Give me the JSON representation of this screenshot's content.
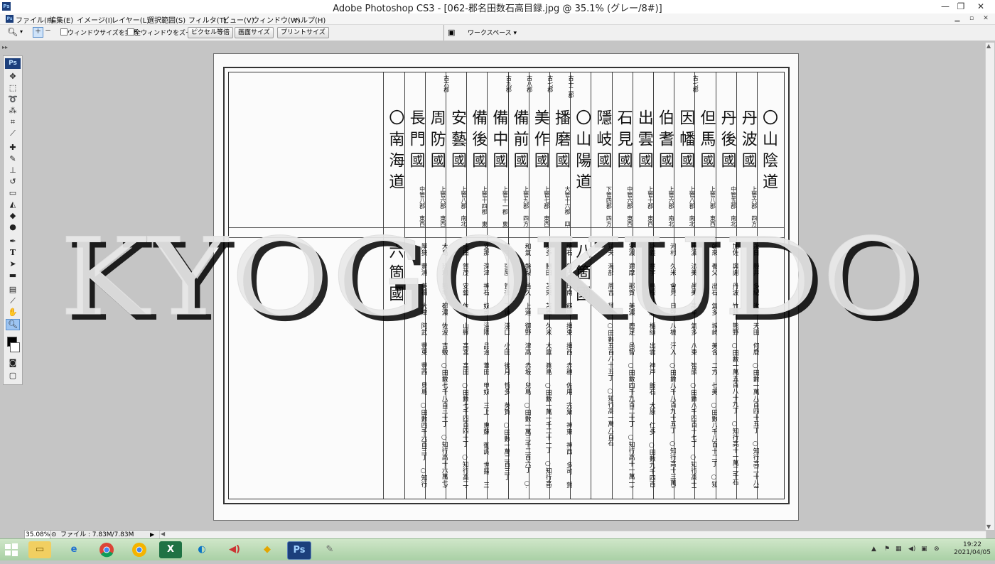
{
  "window": {
    "title": "Adobe Photoshop CS3 - [062-郡名田数石高目録.jpg @ 35.1% (グレー/8#)]",
    "app_icon": "Ps"
  },
  "menu": {
    "items": [
      "ファイル(F)",
      "編集(E)",
      "イメージ(I)",
      "レイヤー(L)",
      "選択範囲(S)",
      "フィルタ(T)",
      "ビュー(V)",
      "ウィンドウ(W)",
      "ヘルプ(H)"
    ]
  },
  "options": {
    "resize_windows_label": "ウィンドウサイズを変更",
    "zoom_all_label": "全ウィンドウをズーム",
    "actual_pixels_label": "ピクセル等倍",
    "fit_screen_label": "画面サイズ",
    "print_size_label": "プリントサイズ",
    "workspace_label": "ワークスペース ▾"
  },
  "toolbox": {
    "header": "Ps"
  },
  "document": {
    "columns_right_to_left": [
      {
        "id": "c1",
        "kind": "heading",
        "text": "〇山陰道"
      },
      {
        "id": "c2",
        "kind": "province",
        "text": "丹波國",
        "note": "上管六郡 四方三日",
        "detail": "永日 般井 多紀 氷上 天田 何鹿 ○田數一萬八百四十五丁 ○知行高二十八萬五千七十石"
      },
      {
        "id": "c3",
        "kind": "province",
        "text": "丹後國",
        "note": "中管五郡 南北一日半",
        "detail": "加佐 與謝 丹波 竹野 熊野 ○田數一萬五百八十九丁 ○知行高十一萬二千石"
      },
      {
        "id": "c4",
        "kind": "province",
        "text": "但馬國",
        "note": "上管八郡 東西二日",
        "detail": "朝來 養父 出石 氣多 城崎 美含 二方 七美 ○田數八千八百十二丁 ○知行高十一萬四千石"
      },
      {
        "id": "c5",
        "kind": "province",
        "text": "因幡國",
        "note": "上管八郡 南北一日",
        "top": "古七郡",
        "detail": "巨濃 法美 邑美 高草 氣多 八東 智頭 ○田數八千四百十七丁 ○知行高十三萬四千石"
      },
      {
        "id": "c6",
        "kind": "province",
        "text": "伯耆國",
        "note": "上管六郡 南北二日半",
        "detail": "河村 久米 會見 日野 八橋 汗入 ○田數八千八百九十五丁 ○知行高十三萬五千石"
      },
      {
        "id": "c7",
        "kind": "province",
        "text": "出雲國",
        "note": "上管十郡 東西一日",
        "detail": "能義 意宇 島根 秋鹿 楯縫 出雲 神戸 飯石 大原 仁多 ○田數九千四百六十五丁 ○知行高十八萬六千石"
      },
      {
        "id": "c8",
        "kind": "province",
        "text": "石見國",
        "note": "中管六郡 東西三日",
        "detail": "安濃 邇摩 那賀 美濃 鹿足 邑智 ○田數四千九百二十丁 ○知行高十一萬一千石"
      },
      {
        "id": "c9",
        "kind": "province",
        "text": "隱岐國",
        "note": "下管四郡 四方一日",
        "detail": "知夫 海部 周吉 穩地 ○田數五百八十五丁 ○知行高一萬八百石"
      },
      {
        "id": "c10",
        "kind": "heading",
        "text": "〇山陽道",
        "detail": "八箇國"
      },
      {
        "id": "c11",
        "kind": "province",
        "text": "播磨國",
        "note": "大管十六郡 四方三日半",
        "top": "古十二郡",
        "detail": "明石 賀古 印南 餝磨 揖東 揖西 赤穗 佐用 宍粟 神東 神西 多可 賀茂 美嚢 ○田數二萬一千四百十四丁 ○知行高五十二萬三千五百石"
      },
      {
        "id": "c12",
        "kind": "province",
        "text": "美作國",
        "note": "上管七郡 東西三日半",
        "top": "古七郡",
        "detail": "英多 勝田 苫東 苫西 久米 大庭 眞島 ○田數一萬一千二十一丁 ○知行高二十二萬九千石"
      },
      {
        "id": "c13",
        "kind": "province",
        "text": "備前國",
        "note": "上管九郡 四方二日",
        "top": "古八郡",
        "detail": "和氣 磐梨 邑久 上道 御野 津高 赤坂 兒島 ○田數一萬三千二百六丁 ○知行高二十八萬六千二百石"
      },
      {
        "id": "c14",
        "kind": "province",
        "text": "備中國",
        "note": "上管十一郡 東西三日半",
        "top": "古九郡",
        "detail": "都宇 窪屋 賀夜 下道 淺口 小田 後月 哲多 英賀 ○田數一萬二百三丁 ○知行高二十七萬八千九百石"
      },
      {
        "id": "c15",
        "kind": "province",
        "text": "備後國",
        "note": "上管十四郡 東西二日余",
        "detail": "安那 深津 神石 奴可 沼隈 品治 葦田 甲奴 三上 惠蘇 御調 世羅 三谿 三次 ○田數九千三百一丁 ○知行高二十四萬一千二百石"
      },
      {
        "id": "c16",
        "kind": "province",
        "text": "安藝國",
        "note": "上管八郡 南北二日半",
        "detail": "沼田 賀茂 安藝 佐伯 山縣 高宮 高田 ○田數七千四百四十丁 ○知行高二十六萬八千二百石"
      },
      {
        "id": "c17",
        "kind": "province",
        "text": "周防國",
        "note": "上管六郡 東西三日",
        "top": "古六郡",
        "detail": "大島 玖珂 熊毛 都濃 佐波 吉敷 ○田數七千八百三十丁 ○知行高十六萬七千八百石"
      },
      {
        "id": "c18",
        "kind": "province",
        "text": "長門國",
        "note": "中管八郡 東西二日半",
        "detail": "厚狹 豐浦 美禰 大津 阿武 豐東 豐西 見島 ○田數四千六百三丁 ○知行高十三萬石"
      },
      {
        "id": "c19",
        "kind": "heading",
        "text": "〇南海道",
        "detail": "六箇國"
      }
    ]
  },
  "watermark": {
    "text": "KYOGOKUDO"
  },
  "status": {
    "zoom": "35.08%",
    "file_info": "ファイル : 7.83M/7.83M"
  },
  "taskbar": {
    "apps": [
      "explorer",
      "ie",
      "chrome",
      "chrome-alt",
      "excel",
      "edge",
      "volume",
      "paint",
      "photoshop",
      "tools"
    ],
    "photoshop_label": "Ps",
    "time": "19:22",
    "date": "2021/04/05"
  },
  "colors": {
    "taskbar": "#b7dbb2",
    "ps_blue": "#1c3f7c",
    "canvas_bg": "#c5c5c5"
  }
}
